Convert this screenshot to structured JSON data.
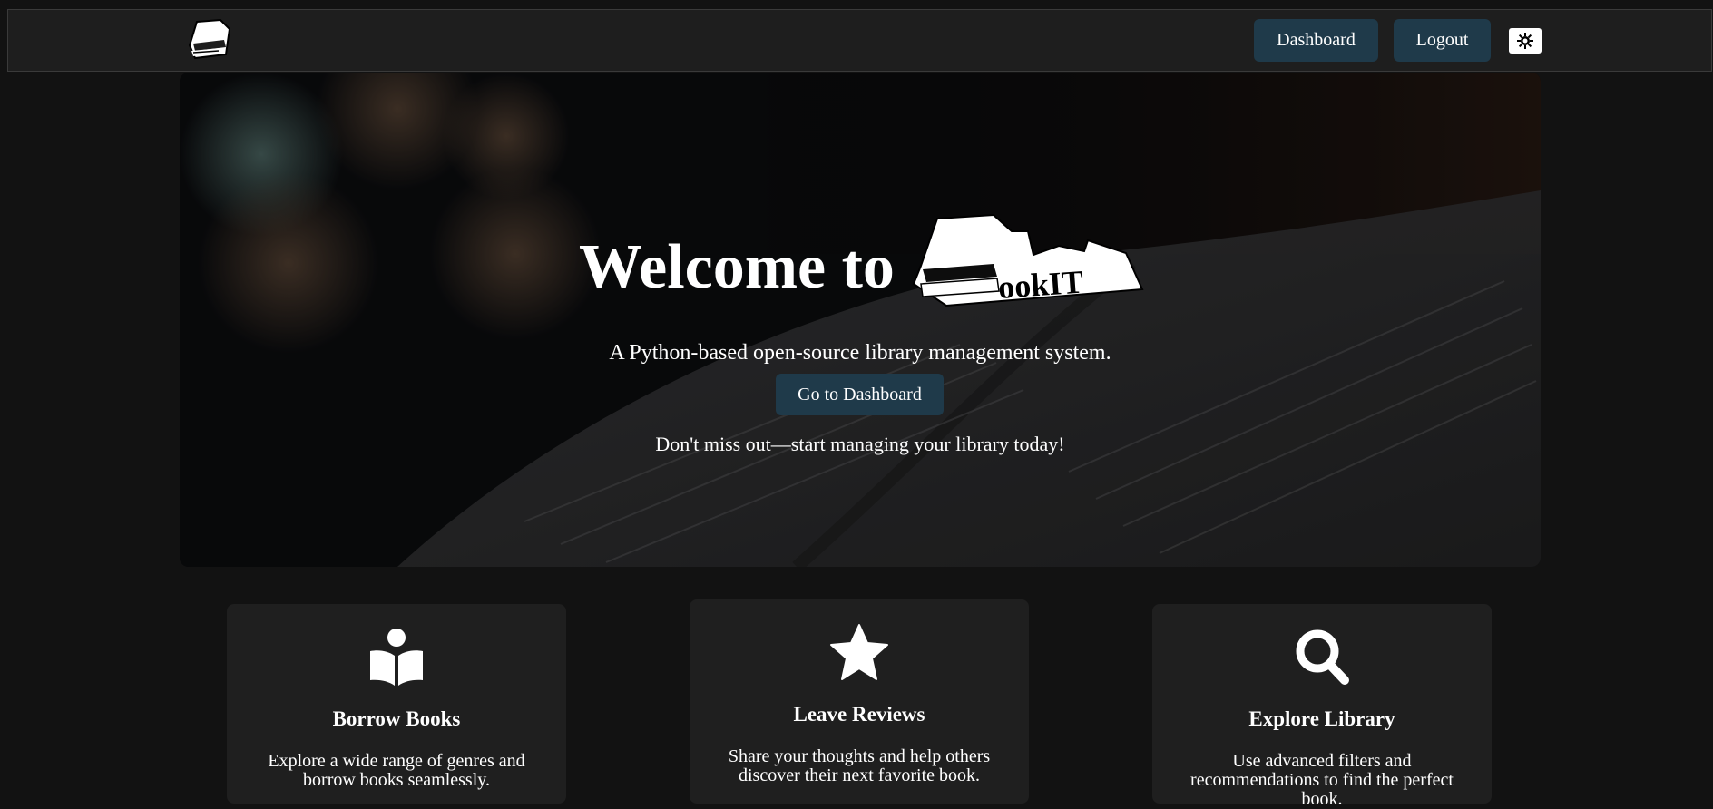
{
  "navbar": {
    "logo_icon": "book-stack-icon",
    "dashboard_label": "Dashboard",
    "logout_label": "Logout",
    "theme_toggle_icon": "sun-gear-icon"
  },
  "hero": {
    "heading": "Welcome to",
    "brand_logo_text": "BookIT",
    "tagline": "A Python-based open-source library management system.",
    "cta_label": "Go to Dashboard",
    "note": "Don't miss out—start managing your library today!"
  },
  "features": [
    {
      "icon": "open-book-reader-icon",
      "title": "Borrow Books",
      "text": "Explore a wide range of genres and borrow books seamlessly."
    },
    {
      "icon": "star-icon",
      "title": "Leave Reviews",
      "text": "Share your thoughts and help others discover their next favorite book."
    },
    {
      "icon": "magnifier-icon",
      "title": "Explore Library",
      "text": "Use advanced filters and recommendations to find the perfect book."
    }
  ],
  "colors": {
    "page_bg": "#121212",
    "navbar_bg": "#1e1e1e",
    "button_bg": "#1f3a4a",
    "card_bg": "#1f1f1f",
    "text": "#ffffff"
  }
}
